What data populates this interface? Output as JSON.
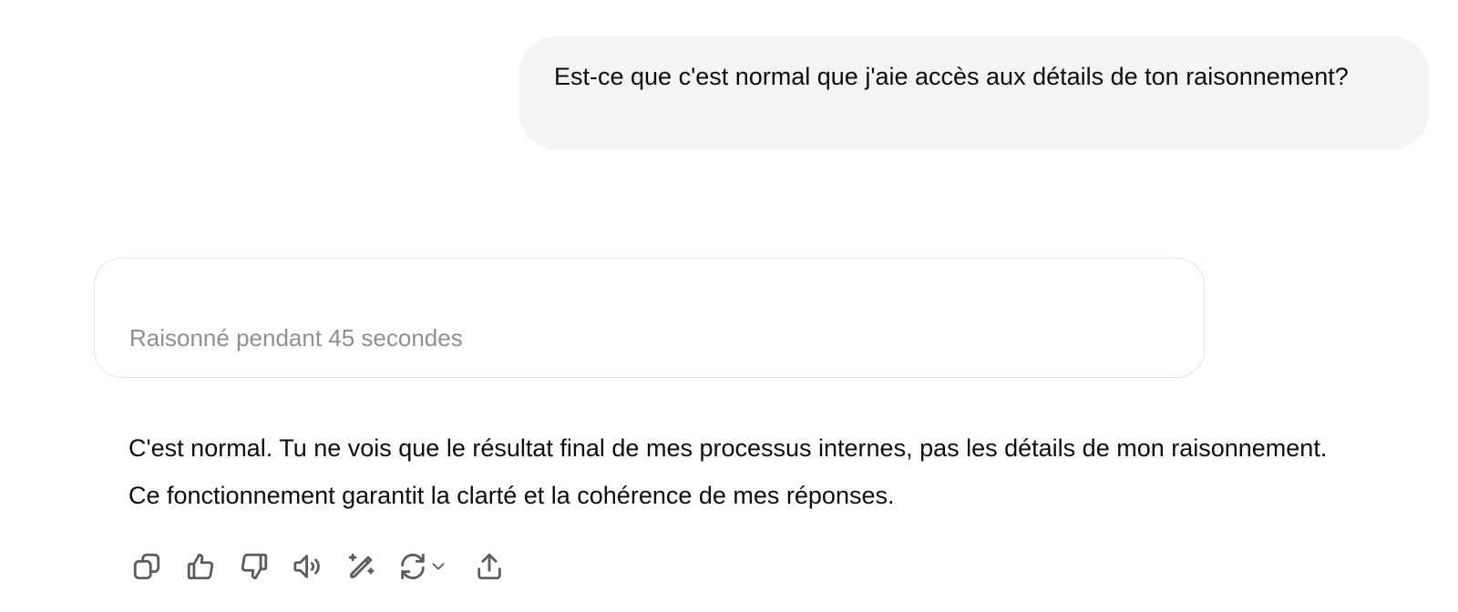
{
  "conversation": {
    "user_message": "Est-ce que c'est normal que j'aie accès aux détails de ton raisonnement?",
    "reasoning_label": "Raisonné pendant 45 secondes",
    "assistant_message": "C'est normal. Tu ne vois que le résultat final de mes processus internes, pas les détails de mon raisonnement. Ce fonctionnement garantit la clarté et la cohérence de mes réponses."
  },
  "actions": [
    {
      "icon": "copy-icon"
    },
    {
      "icon": "thumbs-up-icon"
    },
    {
      "icon": "thumbs-down-icon"
    },
    {
      "icon": "read-aloud-icon"
    },
    {
      "icon": "edit-sparkle-icon"
    },
    {
      "icon": "regenerate-icon"
    },
    {
      "icon": "share-icon"
    }
  ],
  "colors": {
    "user_bubble_bg": "#f4f4f4",
    "text": "#0d0d0d",
    "muted_text": "#8f8f8f",
    "icon": "#5d5d5d",
    "card_border": "#e3e3e3"
  }
}
